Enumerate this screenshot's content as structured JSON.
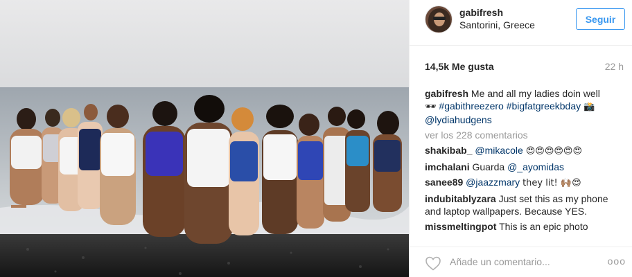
{
  "post": {
    "username": "gabifresh",
    "location": "Santorini, Greece",
    "follow_label": "Seguir",
    "likes": "14,5k Me gusta",
    "time": "22 h"
  },
  "caption": {
    "user": "gabifresh",
    "text": "Me and all my ladies doin well",
    "emoji_1": "🕶",
    "hashtag_1": "#gabithreezero",
    "hashtag_2": "#bigfatgreekbday",
    "emoji_2": "📸",
    "mention": "@lydiahudgens"
  },
  "more_comments": "ver los 228 comentarios",
  "comments": [
    {
      "user": "shakibab_",
      "mention": "@mikacole",
      "text": "😍😍😍😍😍😍"
    },
    {
      "user": "imchalani",
      "text": "Guarda",
      "mention": "@_ayomidas"
    },
    {
      "user": "sanee89",
      "mention": "@jaazzmary",
      "text": "they lit! 🙌🏽😍"
    },
    {
      "user": "indubitablyzara",
      "text": "Just set this as my phone and laptop wallpapers. Because YES."
    },
    {
      "user": "missmeltingpot",
      "text": "This is an epic photo"
    }
  ],
  "footer": {
    "add_comment_placeholder": "Añade un comentario...",
    "more_icon": "ooo"
  },
  "icons": {
    "heart": "heart-icon",
    "options": "more-options-icon"
  },
  "colors": {
    "link": "#003569",
    "follow_blue": "#3897f0",
    "muted": "#999999"
  }
}
